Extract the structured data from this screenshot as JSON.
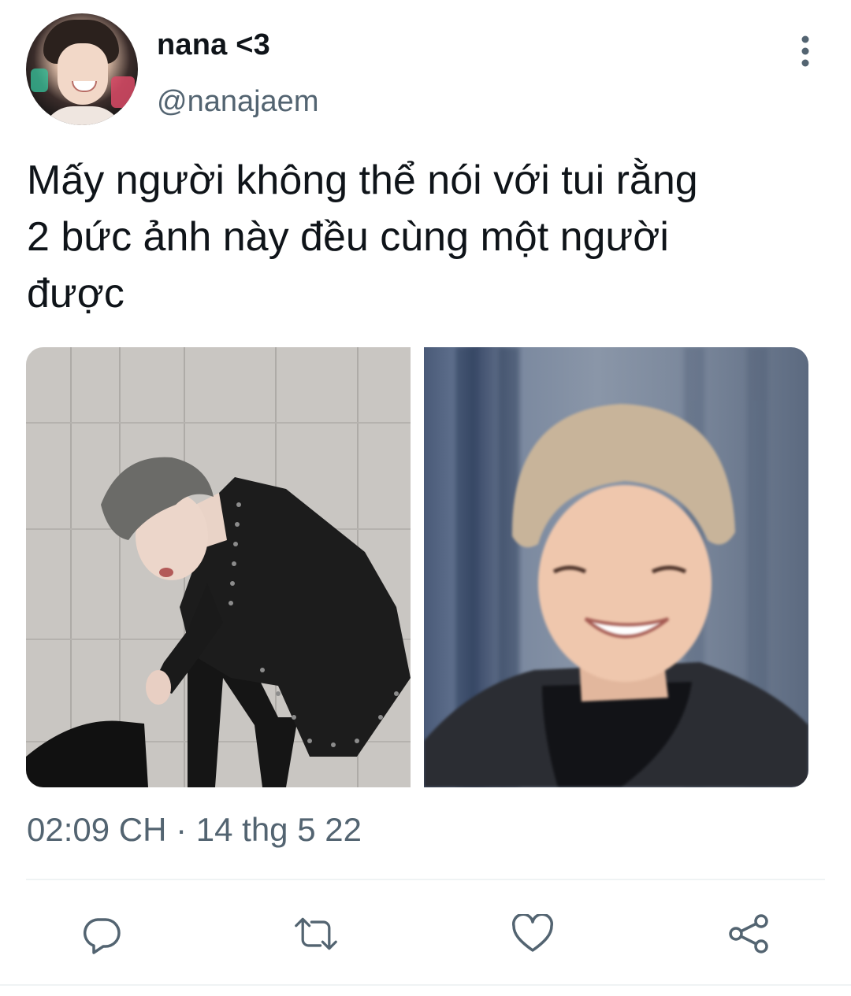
{
  "tweet": {
    "display_name": "nana <3",
    "handle": "@nanajaem",
    "text": "Mấy người không thể nói với tui rằng\n2 bức ảnh này đều cùng một người\nđược",
    "timestamp": "02:09 CH · 14 thg 5 22",
    "media_count": 2
  },
  "icons": {
    "more": "more-vertical-icon",
    "reply": "reply-icon",
    "retweet": "retweet-icon",
    "like": "heart-icon",
    "share": "share-icon"
  },
  "colors": {
    "text_primary": "#0f1419",
    "text_secondary": "#536471",
    "divider": "#eff3f4"
  }
}
